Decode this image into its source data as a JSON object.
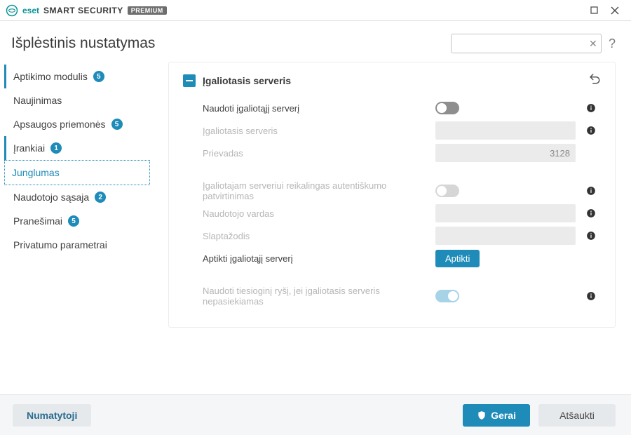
{
  "titlebar": {
    "brand": "SMART SECURITY",
    "edition": "PREMIUM"
  },
  "header": {
    "title": "Išplėstinis nustatymas",
    "search_placeholder": ""
  },
  "sidebar": {
    "items": [
      {
        "label": "Aptikimo modulis",
        "badge": "5",
        "marked": true
      },
      {
        "label": "Naujinimas",
        "badge": null,
        "marked": false
      },
      {
        "label": "Apsaugos priemonės",
        "badge": "5",
        "marked": false
      },
      {
        "label": "Įrankiai",
        "badge": "1",
        "marked": true
      },
      {
        "label": "Junglumas",
        "badge": null,
        "marked": false,
        "selected": true
      },
      {
        "label": "Naudotojo sąsaja",
        "badge": "2",
        "marked": false
      },
      {
        "label": "Pranešimai",
        "badge": "5",
        "marked": false
      },
      {
        "label": "Privatumo parametrai",
        "badge": null,
        "marked": false
      }
    ]
  },
  "panel": {
    "section_title": "Įgaliotasis serveris",
    "rows": {
      "use_proxy": "Naudoti įgaliotąjį serverį",
      "proxy_server": "Įgaliotasis serveris",
      "port": "Prievadas",
      "port_value": "3128",
      "need_auth": "Įgaliotajam serveriui reikalingas autentiškumo patvirtinimas",
      "username": "Naudotojo vardas",
      "password": "Slaptažodis",
      "detect_label": "Aptikti įgaliotąjį serverį",
      "detect_button": "Aptikti",
      "fallback": "Naudoti tiesioginį ryšį, jei įgaliotasis serveris nepasiekiamas"
    }
  },
  "footer": {
    "default": "Numatytoji",
    "ok": "Gerai",
    "cancel": "Atšaukti"
  }
}
